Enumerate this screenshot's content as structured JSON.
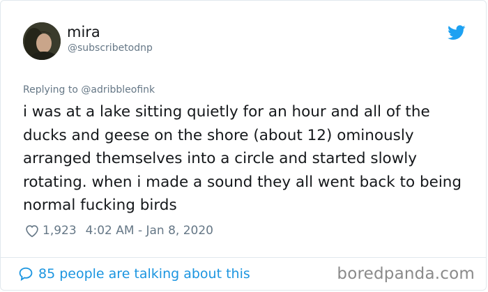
{
  "user": {
    "display_name": "mira",
    "handle": "@subscribetodnp",
    "avatar_icon": "profile-photo"
  },
  "reply": {
    "text": "Replying to @adribbleofink"
  },
  "tweet": {
    "text": "i was at a lake sitting quietly for an hour and all of the ducks and geese on the shore (about 12) ominously arranged themselves into a circle and started slowly rotating. when i made a sound they all went back to being normal fucking birds"
  },
  "meta": {
    "likes": "1,923",
    "timestamp": "4:02 AM - Jan 8, 2020",
    "like_icon": "heart-icon"
  },
  "footer": {
    "talking": "85 people are talking about this",
    "talking_icon": "speech-bubble-icon",
    "watermark": "boredpanda.com"
  },
  "colors": {
    "twitter_blue": "#1da1f2",
    "link_blue": "#1b95e0",
    "secondary_text": "#657786",
    "primary_text": "#14171a",
    "border": "#e1e8ed"
  },
  "icons": {
    "brand": "twitter-bird-icon"
  }
}
